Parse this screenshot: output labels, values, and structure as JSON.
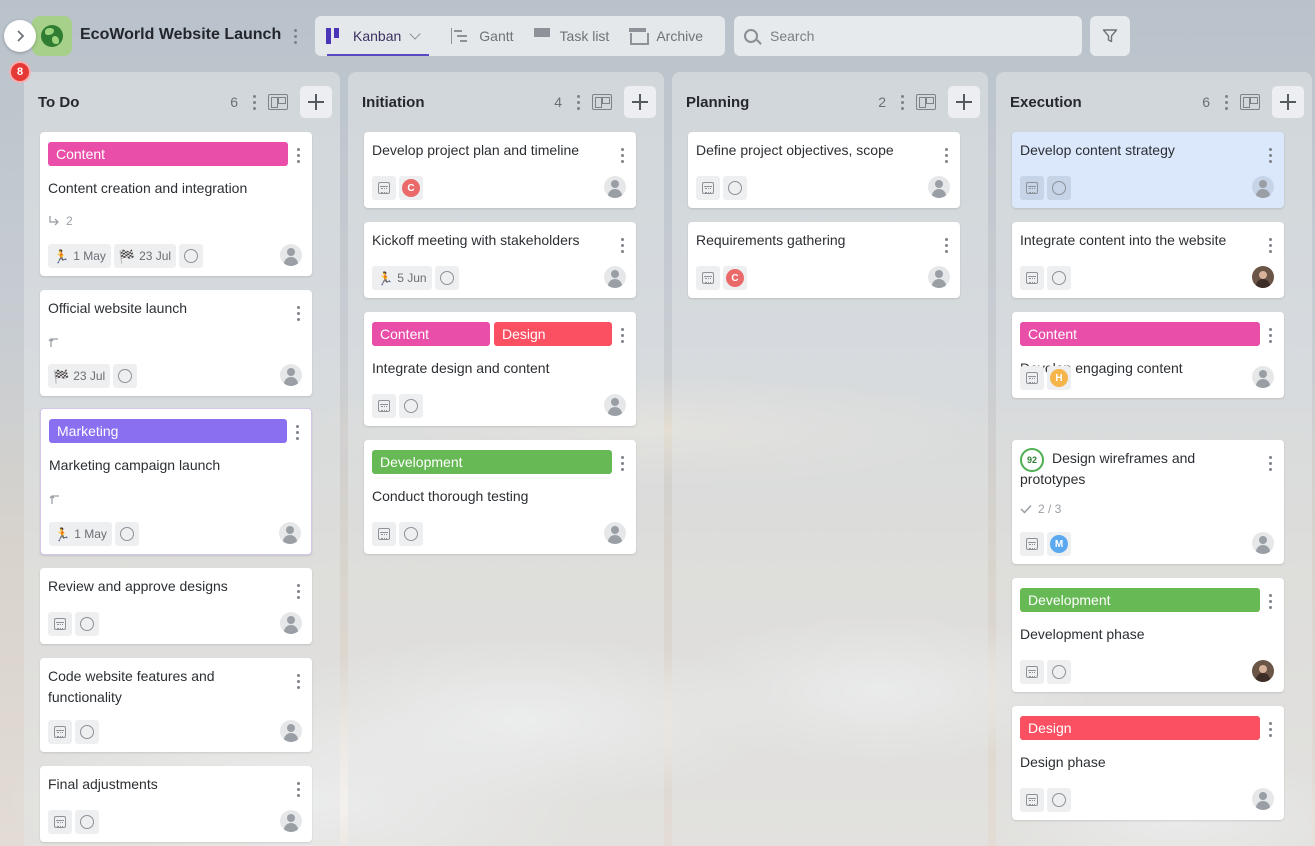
{
  "app": {
    "project_title": "EcoWorld Website Launch",
    "notification_count": "8"
  },
  "views": {
    "tabs": [
      {
        "label": "Kanban",
        "active": true,
        "icon": "kanban-icon"
      },
      {
        "label": "Gantt",
        "active": false,
        "icon": "gantt-icon"
      },
      {
        "label": "Task list",
        "active": false,
        "icon": "list-icon"
      },
      {
        "label": "Archive",
        "active": false,
        "icon": "archive-icon"
      }
    ]
  },
  "search": {
    "placeholder": "Search"
  },
  "colors": {
    "content": "#e94fa8",
    "design": "#fb5062",
    "development": "#66b954",
    "marketing": "#8a6ff0",
    "selected_card": "#dbe7fb",
    "accent": "#5a47c4"
  },
  "columns": [
    {
      "title": "To Do",
      "count": "6",
      "cards": [
        {
          "tags": [
            "Content"
          ],
          "title": "Content creation and integration",
          "subtasks": "2",
          "start_date": "1 May",
          "end_date": "23 Jul"
        },
        {
          "title": "Official website launch",
          "end_date": "23 Jul"
        },
        {
          "tags": [
            "Marketing"
          ],
          "title": "Marketing campaign launch",
          "start_date": "1 May"
        },
        {
          "title": "Review and approve designs"
        },
        {
          "title": "Code website features and functionality"
        },
        {
          "title": "Final adjustments"
        }
      ]
    },
    {
      "title": "Initiation",
      "count": "4",
      "cards": [
        {
          "title": "Develop project plan and timeline",
          "user_initial": "C"
        },
        {
          "title": "Kickoff meeting with stakeholders",
          "start_date": "5 Jun"
        },
        {
          "tags": [
            "Content",
            "Design"
          ],
          "title": "Integrate design and content"
        },
        {
          "tags": [
            "Development"
          ],
          "title": "Conduct thorough testing"
        }
      ]
    },
    {
      "title": "Planning",
      "count": "2",
      "cards": [
        {
          "title": "Define project objectives, scope"
        },
        {
          "title": "Requirements gathering",
          "user_initial": "C"
        }
      ]
    },
    {
      "title": "Execution",
      "count": "6",
      "cards": [
        {
          "title": "Develop content strategy"
        },
        {
          "title": "Integrate content into the website"
        },
        {
          "tags": [
            "Content"
          ],
          "title": "Develop engaging content",
          "user_initial": "H"
        },
        {
          "title": "Design wireframes and prototypes",
          "progress": "92",
          "checklist": "2 / 3",
          "user_initial": "M"
        },
        {
          "tags": [
            "Development"
          ],
          "title": "Development phase"
        },
        {
          "tags": [
            "Design"
          ],
          "title": "Design phase"
        }
      ]
    }
  ]
}
